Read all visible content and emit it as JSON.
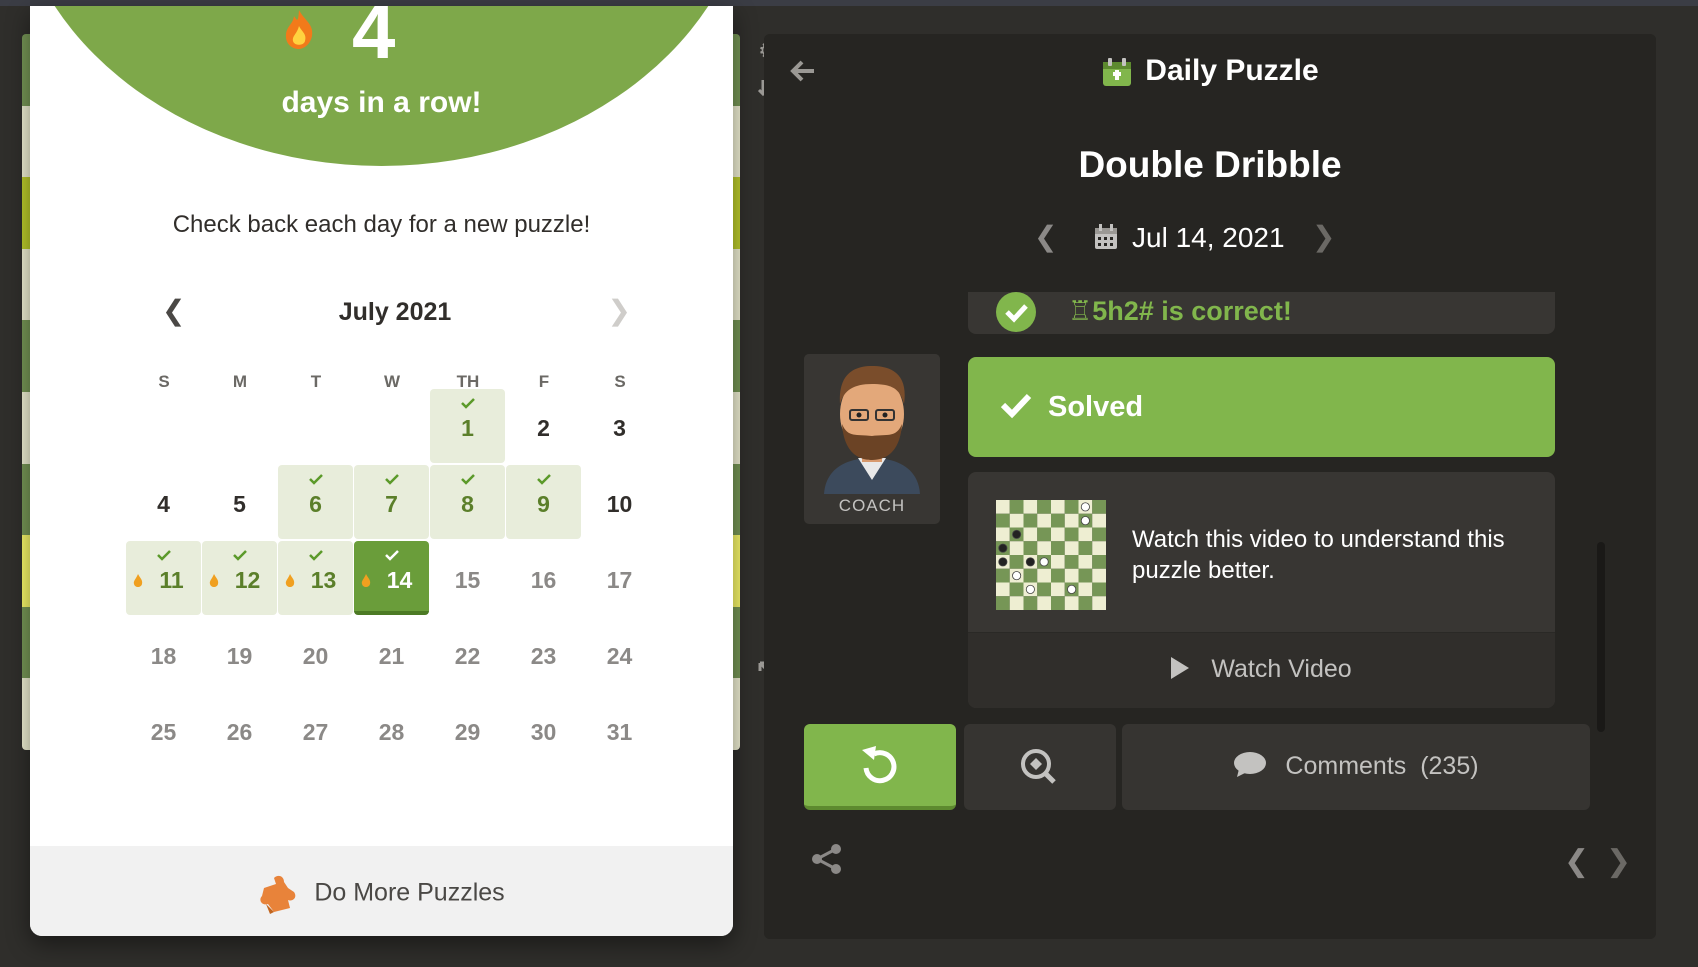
{
  "streak": {
    "count": "4",
    "label": "days in a row!",
    "subtitle": "Check back each day for a new puzzle!"
  },
  "calendar": {
    "month": "July 2021",
    "weekdays": [
      "S",
      "M",
      "T",
      "W",
      "TH",
      "F",
      "S"
    ],
    "days": [
      {
        "n": "1",
        "state": "solved",
        "streak": false
      },
      {
        "n": "2",
        "state": "normal",
        "streak": false
      },
      {
        "n": "3",
        "state": "normal",
        "streak": false
      },
      {
        "n": "4",
        "state": "normal",
        "streak": false
      },
      {
        "n": "5",
        "state": "normal",
        "streak": false
      },
      {
        "n": "6",
        "state": "solved",
        "streak": false
      },
      {
        "n": "7",
        "state": "solved",
        "streak": false
      },
      {
        "n": "8",
        "state": "solved",
        "streak": false
      },
      {
        "n": "9",
        "state": "solved",
        "streak": false
      },
      {
        "n": "10",
        "state": "normal",
        "streak": false
      },
      {
        "n": "11",
        "state": "solved",
        "streak": true
      },
      {
        "n": "12",
        "state": "solved",
        "streak": true
      },
      {
        "n": "13",
        "state": "solved",
        "streak": true
      },
      {
        "n": "14",
        "state": "today",
        "streak": true
      },
      {
        "n": "15",
        "state": "future",
        "streak": false
      },
      {
        "n": "16",
        "state": "future",
        "streak": false
      },
      {
        "n": "17",
        "state": "future",
        "streak": false
      },
      {
        "n": "18",
        "state": "future",
        "streak": false
      },
      {
        "n": "19",
        "state": "future",
        "streak": false
      },
      {
        "n": "20",
        "state": "future",
        "streak": false
      },
      {
        "n": "21",
        "state": "future",
        "streak": false
      },
      {
        "n": "22",
        "state": "future",
        "streak": false
      },
      {
        "n": "23",
        "state": "future",
        "streak": false
      },
      {
        "n": "24",
        "state": "future",
        "streak": false
      },
      {
        "n": "25",
        "state": "future",
        "streak": false
      },
      {
        "n": "26",
        "state": "future",
        "streak": false
      },
      {
        "n": "27",
        "state": "future",
        "streak": false
      },
      {
        "n": "28",
        "state": "future",
        "streak": false
      },
      {
        "n": "29",
        "state": "future",
        "streak": false
      },
      {
        "n": "30",
        "state": "future",
        "streak": false
      },
      {
        "n": "31",
        "state": "future",
        "streak": false
      }
    ],
    "first_weekday": 4
  },
  "footer": {
    "label": "Do More Puzzles"
  },
  "panel": {
    "title": "Daily Puzzle",
    "puzzle_name": "Double Dribble",
    "date": "Jul 14, 2021",
    "correct_text": "♖5h2# is correct!",
    "coach_label": "COACH",
    "solved_label": "Solved",
    "video_text": "Watch this video to understand this puzzle better.",
    "watch_video": "Watch Video",
    "comments_label": "Comments",
    "comments_count": "(235)"
  },
  "colors": {
    "green": "#81b64c",
    "panel_bg": "#262522",
    "card_bg": "#383633"
  },
  "icons": [
    "settings-gear-icon",
    "flip-board-icon",
    "expand-icon",
    "back-arrow-icon",
    "daily-puzzle-icon",
    "calendar-icon",
    "check-icon",
    "play-icon",
    "retry-icon",
    "analysis-icon",
    "comment-icon",
    "share-icon",
    "flame-icon",
    "puzzle-piece-icon"
  ]
}
